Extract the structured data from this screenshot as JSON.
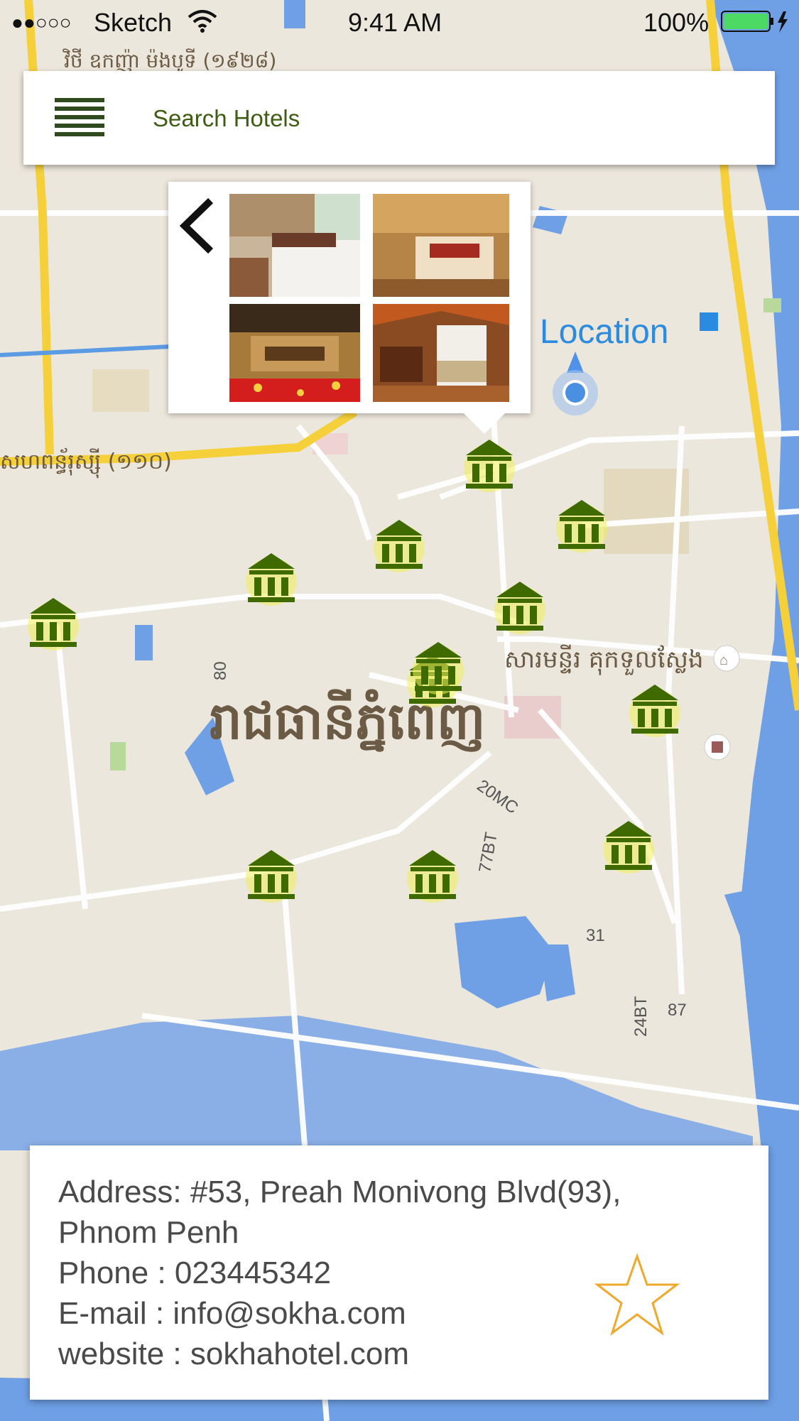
{
  "status_bar": {
    "signal": "●●○○○",
    "carrier": "Sketch",
    "time": "9:41 AM",
    "battery": "100%",
    "battery_color": "#4cd964"
  },
  "search": {
    "placeholder": "Search Hotels",
    "menu_icon": "hamburger-menu-icon"
  },
  "gallery": {
    "back_icon": "chevron-left-icon",
    "photos": [
      "hotel-room-1",
      "hotel-room-2",
      "hotel-room-3",
      "hotel-room-4"
    ]
  },
  "map": {
    "location_label": "Location",
    "city_label": "រាជធានីភ្នំពេញ",
    "labels": {
      "street_top": "វិថី ឧកញ៉ា ម៉ងបូទី (១៩២៨)",
      "street_left": "សហពន្ធ័រុស្ស៊ី (១១០)",
      "landmark": "សារមន្ទីរ គុកទួលស្លែង",
      "road_20mc": "20MC",
      "road_77bt": "77BT",
      "road_31": "31",
      "road_24bt": "24BT",
      "road_87": "87",
      "road_80": "80"
    },
    "colors": {
      "land": "#ece7dc",
      "water": "#6fa0e6",
      "major_road": "#f5d03a",
      "road": "#ffffff",
      "pin": "#3f6a00",
      "pin_glow": "#eef05a"
    }
  },
  "hotel_pins": [
    {
      "name": "hotel-1"
    },
    {
      "name": "hotel-2"
    },
    {
      "name": "hotel-3"
    },
    {
      "name": "hotel-4"
    },
    {
      "name": "hotel-5"
    },
    {
      "name": "hotel-6"
    },
    {
      "name": "hotel-7"
    },
    {
      "name": "hotel-8"
    },
    {
      "name": "hotel-9"
    },
    {
      "name": "hotel-10"
    },
    {
      "name": "hotel-11"
    },
    {
      "name": "hotel-12"
    }
  ],
  "info": {
    "address_line1": "Address: #53, Preah Monivong Blvd(93),",
    "address_line2": "Phnom Penh",
    "phone": "Phone : 023445342",
    "email": "E-mail : info@sokha.com",
    "website": "website : sokhahotel.com",
    "favorite_icon": "star-outline-icon",
    "star_color": "#f0a92a"
  }
}
